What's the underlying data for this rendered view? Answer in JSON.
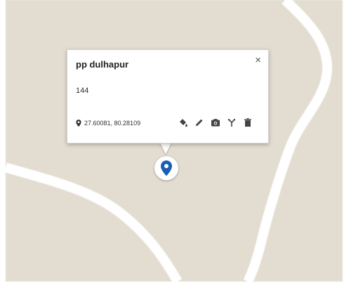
{
  "map": {
    "land_color": "#e3ddd1",
    "road_color": "#ffffff"
  },
  "info_window": {
    "title": "pp dulhapur",
    "close_glyph": "×",
    "description": "144",
    "coordinates": "27.60081, 80.28109",
    "toolbar": [
      {
        "name": "fill-color-icon"
      },
      {
        "name": "edit-pencil-icon"
      },
      {
        "name": "camera-icon"
      },
      {
        "name": "directions-icon"
      },
      {
        "name": "delete-icon"
      }
    ]
  },
  "marker": {
    "color": "#1a5fb4",
    "icon": "map-pin-icon"
  }
}
